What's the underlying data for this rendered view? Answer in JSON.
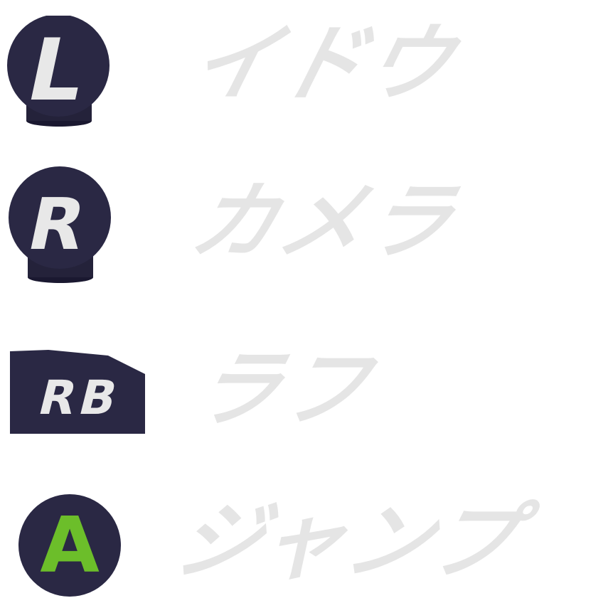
{
  "colors": {
    "button_fill": "#2a2844",
    "button_base": "#1f1d33",
    "label_text": "#e5e5e5",
    "button_letter": "#e8e8e8",
    "a_letter": "#6cbe2a"
  },
  "controls": [
    {
      "button": "L",
      "icon": "left-stick-icon",
      "label": "イドウ"
    },
    {
      "button": "R",
      "icon": "right-stick-icon",
      "label": "カメラ"
    },
    {
      "button": "RB",
      "icon": "right-bumper-icon",
      "label": "ラフ"
    },
    {
      "button": "A",
      "icon": "a-button-icon",
      "label": "ジャンプ"
    }
  ]
}
